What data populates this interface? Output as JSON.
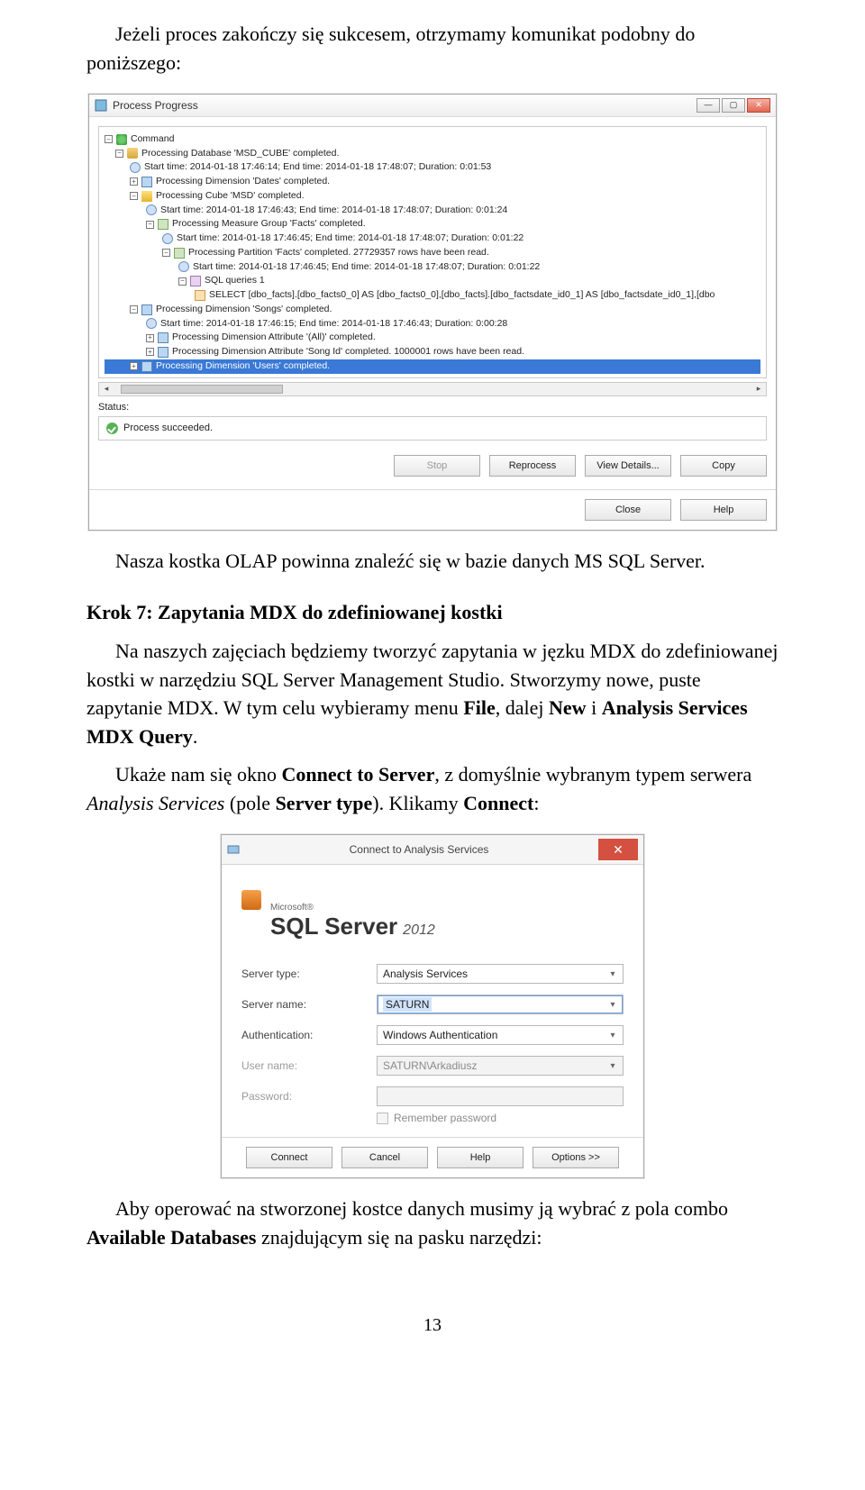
{
  "text": {
    "intro": "Jeżeli proces zakończy się sukcesem, otrzymamy komunikat podobny do poniższego:",
    "after_progress": "Nasza kostka OLAP powinna znaleźć się w bazie danych MS SQL Server.",
    "step7_heading": "Krok 7: Zapytania MDX do zdefiniowanej kostki",
    "step7_p1_a": "Na naszych zajęciach będziemy tworzyć zapytania w jęzku MDX do zdefiniowanej kostki w narzędziu SQL Server Management Studio. Stworzymy nowe, puste zapytanie MDX. W tym celu wybieramy menu ",
    "step7_p1_file": "File",
    "step7_p1_b": ", dalej ",
    "step7_p1_new": "New",
    "step7_p1_c": " i ",
    "step7_p1_asmdx": "Analysis Services MDX Query",
    "step7_p1_d": ".",
    "step7_p2_a": "Ukaże nam się okno ",
    "step7_p2_connect": "Connect to Server",
    "step7_p2_b": ", z domyślnie wybranym typem serwera ",
    "step7_p2_as": "Analysis Services",
    "step7_p2_c": " (pole ",
    "step7_p2_st": "Server type",
    "step7_p2_d": "). Klikamy ",
    "step7_p2_conn": "Connect",
    "step7_p2_e": ":",
    "closing_a": "Aby operować na stworzonej kostce danych musimy ją wybrać z pola combo ",
    "closing_ad": "Available Databases",
    "closing_b": " znajdującym się na pasku narzędzi:",
    "page_number": "13"
  },
  "progress_dialog": {
    "title": "Process Progress",
    "tree": {
      "command": "Command",
      "db": "Processing Database 'MSD_CUBE' completed.",
      "db_time": "Start time: 2014-01-18 17:46:14; End time: 2014-01-18 17:48:07; Duration: 0:01:53",
      "dim_dates": "Processing Dimension 'Dates' completed.",
      "cube": "Processing Cube 'MSD' completed.",
      "cube_time": "Start time: 2014-01-18 17:46:43; End time: 2014-01-18 17:48:07; Duration: 0:01:24",
      "mg_facts": "Processing Measure Group 'Facts' completed.",
      "mg_time": "Start time: 2014-01-18 17:46:45; End time: 2014-01-18 17:48:07; Duration: 0:01:22",
      "partition": "Processing Partition 'Facts' completed. 27729357 rows have been read.",
      "part_time": "Start time: 2014-01-18 17:46:45; End time: 2014-01-18 17:48:07; Duration: 0:01:22",
      "sqlq": "SQL queries 1",
      "select": "SELECT [dbo_facts].[dbo_facts0_0] AS [dbo_facts0_0],[dbo_facts].[dbo_factsdate_id0_1] AS [dbo_factsdate_id0_1],[dbo",
      "dim_songs": "Processing Dimension 'Songs' completed.",
      "songs_time": "Start time: 2014-01-18 17:46:15; End time: 2014-01-18 17:46:43; Duration: 0:00:28",
      "attr_all": "Processing Dimension Attribute '(All)' completed.",
      "attr_song": "Processing Dimension Attribute 'Song Id' completed. 1000001 rows have been read.",
      "dim_users": "Processing Dimension 'Users' completed."
    },
    "status_label": "Status:",
    "status_text": "Process succeeded.",
    "buttons": {
      "stop": "Stop",
      "reprocess": "Reprocess",
      "view_details": "View Details...",
      "copy": "Copy",
      "close": "Close",
      "help": "Help"
    }
  },
  "connect_dialog": {
    "title": "Connect to Analysis Services",
    "brand_ms": "Microsoft®",
    "brand_sql": "SQL Server",
    "brand_year": "2012",
    "labels": {
      "server_type": "Server type:",
      "server_name": "Server name:",
      "auth": "Authentication:",
      "user": "User name:",
      "password": "Password:"
    },
    "values": {
      "server_type": "Analysis Services",
      "server_name": "SATURN",
      "auth": "Windows Authentication",
      "user": "SATURN\\Arkadiusz",
      "password": ""
    },
    "remember": "Remember password",
    "buttons": {
      "connect": "Connect",
      "cancel": "Cancel",
      "help": "Help",
      "options": "Options >>"
    }
  }
}
